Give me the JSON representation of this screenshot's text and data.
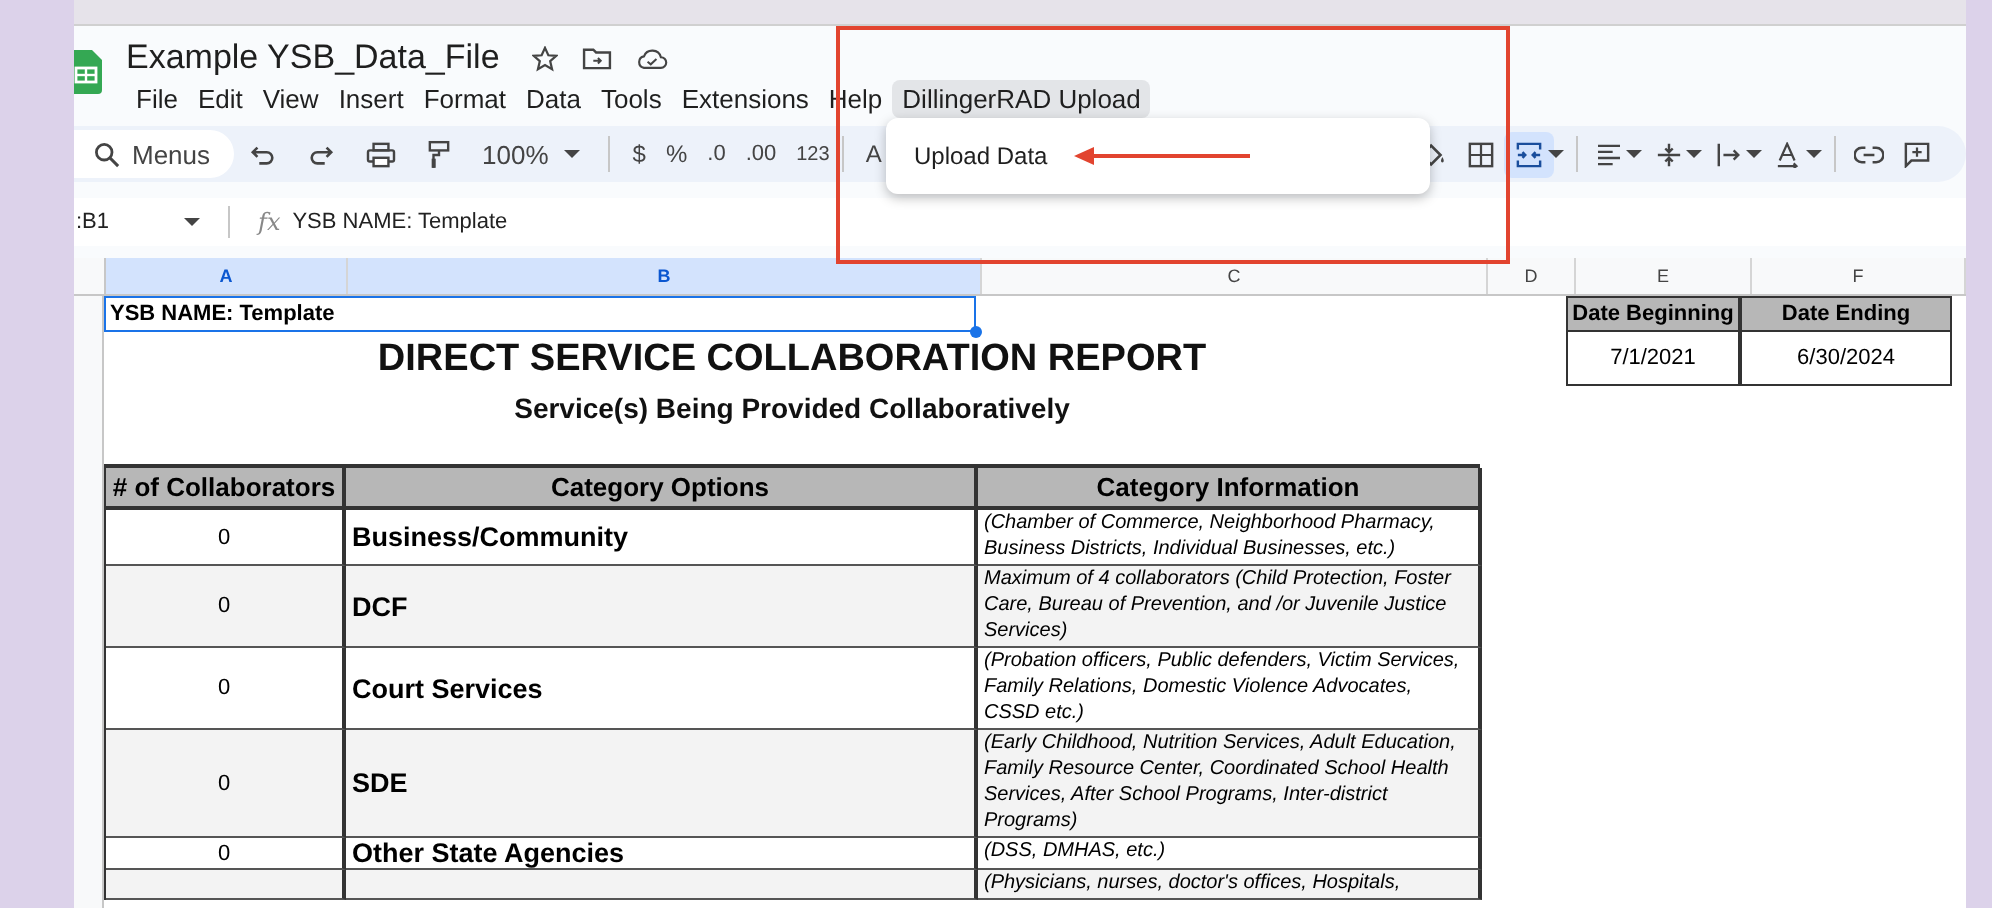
{
  "document": {
    "title": "Example YSB_Data_File"
  },
  "menu_bar": [
    {
      "label": "File",
      "selected": false
    },
    {
      "label": "Edit",
      "selected": false
    },
    {
      "label": "View",
      "selected": false
    },
    {
      "label": "Insert",
      "selected": false
    },
    {
      "label": "Format",
      "selected": false
    },
    {
      "label": "Data",
      "selected": false
    },
    {
      "label": "Tools",
      "selected": false
    },
    {
      "label": "Extensions",
      "selected": false
    },
    {
      "label": "Help",
      "selected": false
    },
    {
      "label": "DillingerRAD Upload",
      "selected": true
    }
  ],
  "dropdown_menu": {
    "items": [
      "Upload Data"
    ]
  },
  "toolbar": {
    "search_placeholder": "Menus",
    "zoom": "100%",
    "currency": "$",
    "percent": "%",
    "decrease_decimals": ".0",
    "increase_decimals": ".00",
    "number_format": "123",
    "font": "A",
    "merge_active": true
  },
  "formula_bar": {
    "cell_ref": ":B1",
    "function_label": "fx",
    "formula": "YSB NAME: Template"
  },
  "columns": [
    {
      "label": "A",
      "selected": true
    },
    {
      "label": "B",
      "selected": true
    },
    {
      "label": "C",
      "selected": false
    },
    {
      "label": "D",
      "selected": false
    },
    {
      "label": "E",
      "selected": false
    },
    {
      "label": "F",
      "selected": false
    }
  ],
  "sheet": {
    "name_cell": "YSB NAME: Template",
    "title": "DIRECT SERVICE COLLABORATION REPORT",
    "subtitle": "Service(s) Being Provided Collaboratively",
    "dates": {
      "headers": [
        "Date Beginning",
        "Date Ending"
      ],
      "values": [
        "7/1/2021",
        "6/30/2024"
      ]
    },
    "table": {
      "columns": [
        "# of Collaborators",
        "Category Options",
        "Category Information"
      ],
      "rows": [
        {
          "count": "0",
          "category": "Business/Community",
          "info": "(Chamber of Commerce, Neighborhood Pharmacy, Business Districts, Individual Businesses, etc.)"
        },
        {
          "count": "0",
          "category": "DCF",
          "info": "Maximum of 4 collaborators  (Child Protection, Foster Care, Bureau of Prevention, and /or Juvenile Justice Services)"
        },
        {
          "count": "0",
          "category": "Court Services",
          "info": "(Probation officers, Public defenders, Victim Services, Family Relations, Domestic Violence Advocates, CSSD etc.)"
        },
        {
          "count": "0",
          "category": "SDE",
          "info": "(Early Childhood, Nutrition Services, Adult Education, Family Resource Center, Coordinated School Health Services, After School Programs, Inter-district Programs)"
        },
        {
          "count": "0",
          "category": "Other State Agencies",
          "info": "(DSS, DMHAS, etc.)"
        },
        {
          "info": "(Physicians, nurses, doctor's offices, Hospitals,"
        }
      ]
    }
  }
}
